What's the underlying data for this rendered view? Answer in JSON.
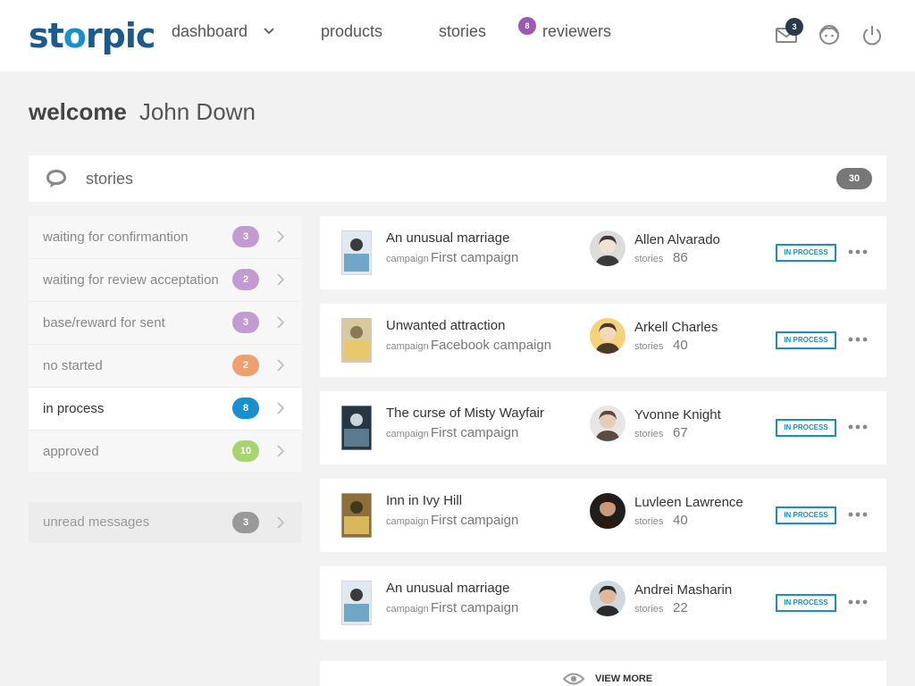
{
  "header": {
    "logo": "storpic",
    "nav": {
      "dashboard": "dashboard",
      "products": "products",
      "stories": "stories",
      "reviewers": "reviewers",
      "reviewers_badge": "8"
    },
    "mail_badge": "3",
    "icons": [
      "mail-icon",
      "face-icon",
      "power-icon",
      "chevron-down-icon"
    ]
  },
  "welcome": {
    "greeting": "welcome",
    "name": "John Down"
  },
  "stories_bar": {
    "title": "stories",
    "count": "30",
    "icon": "chat-bubble-icon"
  },
  "filters": [
    {
      "label": "waiting for confirmantion",
      "count": "3",
      "color": "#c39bd3",
      "active": false
    },
    {
      "label": "waiting for review acceptation",
      "count": "2",
      "color": "#c39bd3",
      "active": false
    },
    {
      "label": "base/reward for sent",
      "count": "3",
      "color": "#c39bd3",
      "active": false
    },
    {
      "label": "no started",
      "count": "2",
      "color": "#f0a070",
      "active": false
    },
    {
      "label": "in process",
      "count": "8",
      "color": "#1a8fd0",
      "active": true
    },
    {
      "label": "approved",
      "count": "10",
      "color": "#a8d46f",
      "active": false
    }
  ],
  "unread": {
    "label": "unread messages",
    "count": "3"
  },
  "cards": [
    {
      "title": "An unusual marriage",
      "campaign_label": "campaign",
      "campaign": "First campaign",
      "reviewer": "Allen Alvarado",
      "stories_label": "stories",
      "stories": "86",
      "status": "IN PROCESS"
    },
    {
      "title": "Unwanted attraction",
      "campaign_label": "campaign",
      "campaign": "Facebook campaign",
      "reviewer": "Arkell Charles",
      "stories_label": "stories",
      "stories": "40",
      "status": "IN PROCESS"
    },
    {
      "title": "The curse of Misty Wayfair",
      "campaign_label": "campaign",
      "campaign": "First campaign",
      "reviewer": "Yvonne Knight",
      "stories_label": "stories",
      "stories": "67",
      "status": "IN PROCESS"
    },
    {
      "title": "Inn in Ivy Hill",
      "campaign_label": "campaign",
      "campaign": "First campaign",
      "reviewer": "Luvleen Lawrence",
      "stories_label": "stories",
      "stories": "40",
      "status": "IN PROCESS"
    },
    {
      "title": "An unusual marriage",
      "campaign_label": "campaign",
      "campaign": "First campaign",
      "reviewer": "Andrei Masharin",
      "stories_label": "stories",
      "stories": "22",
      "status": "IN PROCESS"
    }
  ],
  "view_more": "VIEW MORE",
  "colors": {
    "brand": "#1a5a8c",
    "accent": "#1a8fbf",
    "badge_purple": "#9b59b6"
  }
}
